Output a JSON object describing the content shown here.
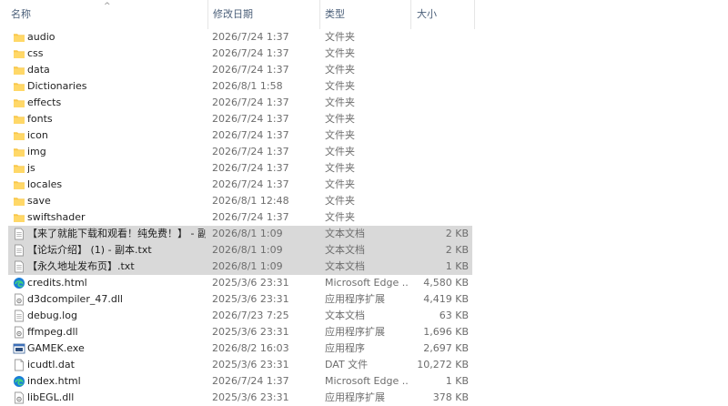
{
  "columns": {
    "name": "名称",
    "date": "修改日期",
    "type": "类型",
    "size": "大小"
  },
  "sort_indicator": "^",
  "files": [
    {
      "name": "audio",
      "date": "2026/7/24 1:37",
      "type": "文件夹",
      "size": "",
      "icon": "folder-icon",
      "selected": false
    },
    {
      "name": "css",
      "date": "2026/7/24 1:37",
      "type": "文件夹",
      "size": "",
      "icon": "folder-icon",
      "selected": false
    },
    {
      "name": "data",
      "date": "2026/7/24 1:37",
      "type": "文件夹",
      "size": "",
      "icon": "folder-icon",
      "selected": false
    },
    {
      "name": "Dictionaries",
      "date": "2026/8/1 1:58",
      "type": "文件夹",
      "size": "",
      "icon": "folder-icon",
      "selected": false
    },
    {
      "name": "effects",
      "date": "2026/7/24 1:37",
      "type": "文件夹",
      "size": "",
      "icon": "folder-icon",
      "selected": false
    },
    {
      "name": "fonts",
      "date": "2026/7/24 1:37",
      "type": "文件夹",
      "size": "",
      "icon": "folder-icon",
      "selected": false
    },
    {
      "name": "icon",
      "date": "2026/7/24 1:37",
      "type": "文件夹",
      "size": "",
      "icon": "folder-icon",
      "selected": false
    },
    {
      "name": "img",
      "date": "2026/7/24 1:37",
      "type": "文件夹",
      "size": "",
      "icon": "folder-icon",
      "selected": false
    },
    {
      "name": "js",
      "date": "2026/7/24 1:37",
      "type": "文件夹",
      "size": "",
      "icon": "folder-icon",
      "selected": false
    },
    {
      "name": "locales",
      "date": "2026/7/24 1:37",
      "type": "文件夹",
      "size": "",
      "icon": "folder-icon",
      "selected": false
    },
    {
      "name": "save",
      "date": "2026/8/1 12:48",
      "type": "文件夹",
      "size": "",
      "icon": "folder-icon",
      "selected": false
    },
    {
      "name": "swiftshader",
      "date": "2026/7/24 1:37",
      "type": "文件夹",
      "size": "",
      "icon": "folder-icon",
      "selected": false
    },
    {
      "name": "【来了就能下载和观看！纯免费！】 - 副...",
      "date": "2026/8/1 1:09",
      "type": "文本文档",
      "size": "2 KB",
      "icon": "text-file-icon",
      "selected": true
    },
    {
      "name": "【论坛介绍】 (1) - 副本.txt",
      "date": "2026/8/1 1:09",
      "type": "文本文档",
      "size": "2 KB",
      "icon": "text-file-icon",
      "selected": true
    },
    {
      "name": "【永久地址发布页】.txt",
      "date": "2026/8/1 1:09",
      "type": "文本文档",
      "size": "1 KB",
      "icon": "text-file-icon",
      "selected": true
    },
    {
      "name": "credits.html",
      "date": "2025/3/6 23:31",
      "type": "Microsoft Edge ...",
      "size": "4,580 KB",
      "icon": "edge-icon",
      "selected": false
    },
    {
      "name": "d3dcompiler_47.dll",
      "date": "2025/3/6 23:31",
      "type": "应用程序扩展",
      "size": "4,419 KB",
      "icon": "dll-icon",
      "selected": false
    },
    {
      "name": "debug.log",
      "date": "2026/7/23 7:25",
      "type": "文本文档",
      "size": "63 KB",
      "icon": "text-file-icon",
      "selected": false
    },
    {
      "name": "ffmpeg.dll",
      "date": "2025/3/6 23:31",
      "type": "应用程序扩展",
      "size": "1,696 KB",
      "icon": "dll-icon",
      "selected": false
    },
    {
      "name": "GAMEK.exe",
      "date": "2026/8/2 16:03",
      "type": "应用程序",
      "size": "2,697 KB",
      "icon": "exe-icon",
      "selected": false
    },
    {
      "name": "icudtl.dat",
      "date": "2025/3/6 23:31",
      "type": "DAT 文件",
      "size": "10,272 KB",
      "icon": "blank-file-icon",
      "selected": false
    },
    {
      "name": "index.html",
      "date": "2026/7/24 1:37",
      "type": "Microsoft Edge ...",
      "size": "1 KB",
      "icon": "edge-icon",
      "selected": false
    },
    {
      "name": "libEGL.dll",
      "date": "2025/3/6 23:31",
      "type": "应用程序扩展",
      "size": "378 KB",
      "icon": "dll-icon",
      "selected": false
    }
  ]
}
